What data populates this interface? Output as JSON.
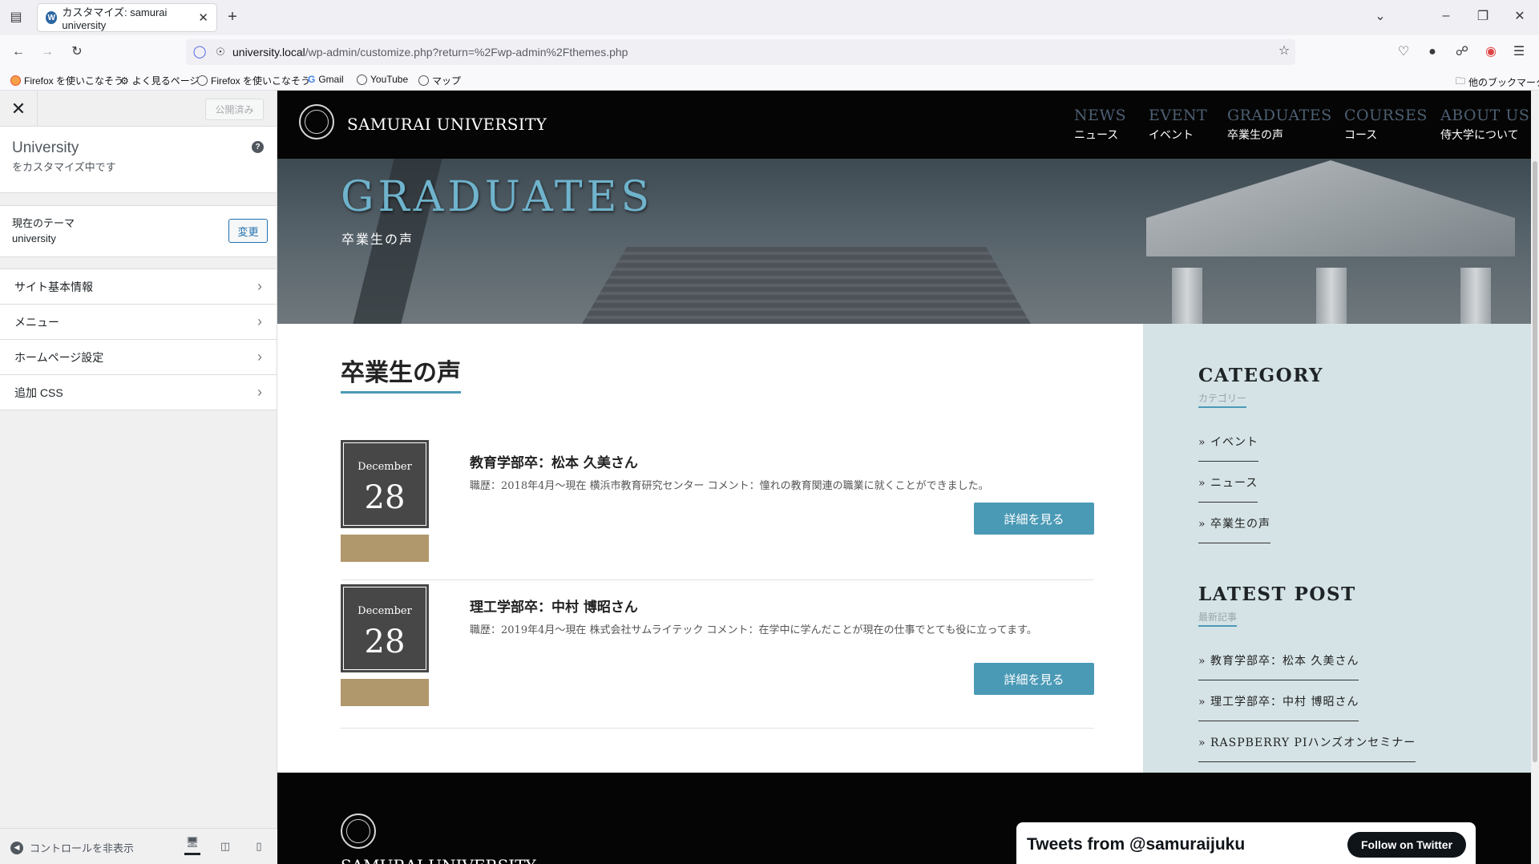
{
  "browser": {
    "tab_title": "カスタマイズ: samurai university",
    "url_host": "university.local",
    "url_path": "/wp-admin/customize.php?return=%2Fwp-admin%2Fthemes.php",
    "bookmarks": [
      "Firefox を使いこなそう",
      "よく見るページ",
      "Firefox を使いこなそう",
      "Gmail",
      "YouTube",
      "マップ"
    ],
    "other_bookmarks": "他のブックマーク"
  },
  "customizer": {
    "published_label": "公開済み",
    "site_name": "University",
    "customizing_text": "をカスタマイズ中です",
    "current_theme_label": "現在のテーマ",
    "current_theme_name": "university",
    "change_label": "変更",
    "sections": [
      "サイト基本情報",
      "メニュー",
      "ホームページ設定",
      "追加 CSS"
    ],
    "hide_controls": "コントロールを非表示"
  },
  "site": {
    "name": "SAMURAI UNIVERSITY",
    "nav": [
      {
        "en": "NEWS",
        "ja": "ニュース"
      },
      {
        "en": "EVENT",
        "ja": "イベント"
      },
      {
        "en": "GRADUATES",
        "ja": "卒業生の声"
      },
      {
        "en": "COURSES",
        "ja": "コース"
      },
      {
        "en": "ABOUT US",
        "ja": "侍大学について"
      }
    ],
    "hero_title": "GRADUATES",
    "hero_subtitle": "卒業生の声",
    "page_heading": "卒業生の声",
    "posts": [
      {
        "month": "December",
        "day": "28",
        "title": "教育学部卒：松本 久美さん",
        "body": "職歴：2018年4月～現在 横浜市教育研究センター コメント：憧れの教育関連の職業に就くことができました。",
        "button": "詳細を見る"
      },
      {
        "month": "December",
        "day": "28",
        "title": "理工学部卒：中村 博昭さん",
        "body": "職歴：2019年4月～現在 株式会社サムライテック コメント：在学中に学んだことが現在の仕事でとても役に立ってます。",
        "button": "詳細を見る"
      }
    ],
    "sidebar": {
      "category_title": "CATEGORY",
      "category_sub": "カテゴリー",
      "categories": [
        "» イベント",
        "» ニュース",
        "» 卒業生の声"
      ],
      "latest_title": "LATEST POST",
      "latest_sub": "最新記事",
      "latest": [
        "» 教育学部卒：松本 久美さん",
        "» 理工学部卒：中村 博昭さん",
        "» RASPBERRY PIハンズオンセミナー"
      ]
    },
    "footer_name": "SAMURAI UNIVERSITY",
    "twitter_title": "Tweets from @samuraijuku",
    "twitter_follow": "Follow on Twitter"
  }
}
